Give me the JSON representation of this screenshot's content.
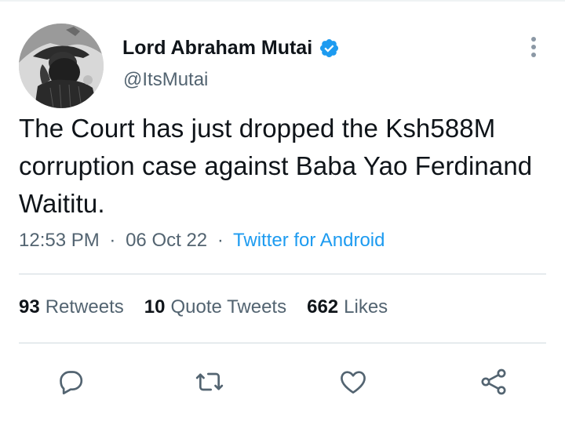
{
  "author": {
    "display_name": "Lord Abraham Mutai",
    "handle": "@ItsMutai",
    "verified": true
  },
  "tweet": {
    "text": "The Court has just dropped the Ksh588M corruption case against Baba Yao Ferdinand Waititu."
  },
  "meta": {
    "time": "12:53 PM",
    "separator": "·",
    "date": "06 Oct 22",
    "source": "Twitter for Android"
  },
  "stats": {
    "retweets_count": "93",
    "retweets_label": "Retweets",
    "quotes_count": "10",
    "quotes_label": "Quote Tweets",
    "likes_count": "662",
    "likes_label": "Likes"
  },
  "icons": {
    "more": "more-vertical-icon",
    "verified": "verified-badge-icon",
    "reply": "reply-icon",
    "retweet": "retweet-icon",
    "like": "heart-icon",
    "share": "share-icon"
  },
  "colors": {
    "accent": "#1d9bf0",
    "text_primary": "#0f1419",
    "text_secondary": "#536471",
    "divider": "#cfd9de"
  }
}
